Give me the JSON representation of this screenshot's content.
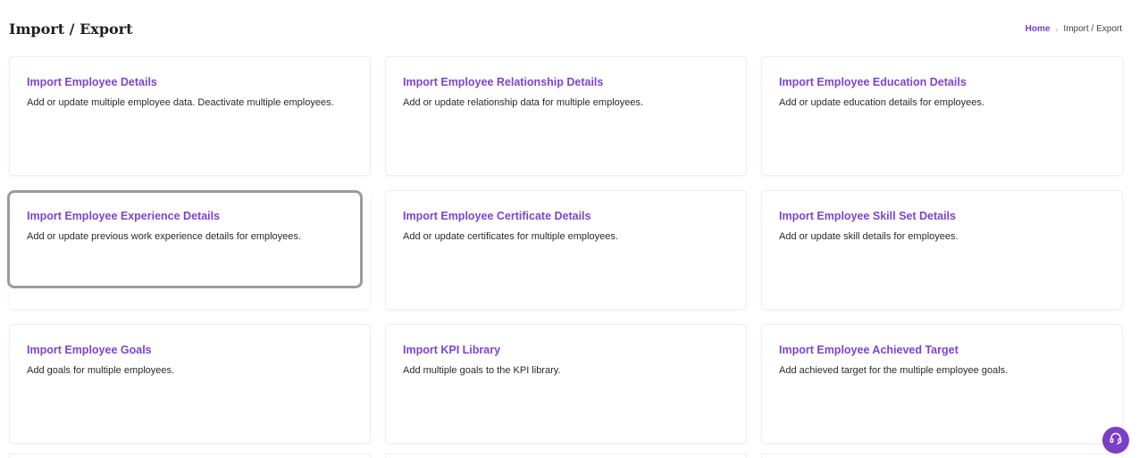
{
  "header": {
    "title": "Import / Export",
    "breadcrumb": {
      "home": "Home",
      "separator": "›",
      "current": "Import / Export"
    }
  },
  "cards": [
    {
      "title": "Import Employee Details",
      "description": "Add or update multiple employee data. Deactivate multiple employees."
    },
    {
      "title": "Import Employee Relationship Details",
      "description": "Add or update relationship data for multiple employees."
    },
    {
      "title": "Import Employee Education Details",
      "description": "Add or update education details for employees."
    },
    {
      "title": "Import Employee Experience Details",
      "description": "Add or update previous work experience details for employees."
    },
    {
      "title": "Import Employee Certificate Details",
      "description": "Add or update certificates for multiple employees."
    },
    {
      "title": "Import Employee Skill Set Details",
      "description": "Add or update skill details for employees."
    },
    {
      "title": "Import Employee Goals",
      "description": "Add goals for multiple employees."
    },
    {
      "title": "Import KPI Library",
      "description": "Add multiple goals to the KPI library."
    },
    {
      "title": "Import Employee Achieved Target",
      "description": "Add achieved target for the multiple employee goals."
    }
  ],
  "help_fab": {
    "icon": "headset-icon"
  },
  "colors": {
    "accent": "#7e45c6",
    "fab": "#7a3fc4",
    "text": "#2a2a2a"
  }
}
